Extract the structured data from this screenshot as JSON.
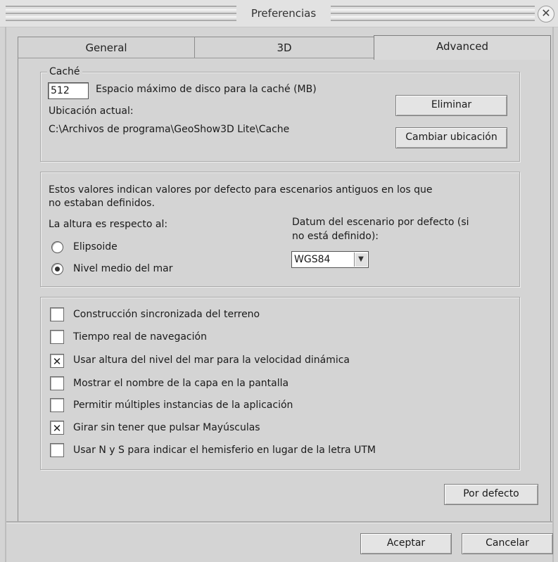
{
  "window": {
    "title": "Preferencias",
    "close_glyph": "✕"
  },
  "tabs": [
    {
      "label": "General",
      "active": false
    },
    {
      "label": "3D",
      "active": false
    },
    {
      "label": "Advanced",
      "active": true
    }
  ],
  "cache": {
    "legend": "Caché",
    "size_value": "512",
    "size_label": "Espacio máximo de disco para la caché (MB)",
    "location_label": "Ubicación actual:",
    "location_path": "C:\\Archivos de programa\\GeoShow3D Lite\\Cache",
    "delete_button": "Eliminar",
    "change_button": "Cambiar ubicación"
  },
  "defaults": {
    "intro_line1": "Estos valores indican valores por defecto para escenarios antiguos en los que",
    "intro_line2": "no estaban definidos.",
    "height_label": "La altura es respecto al:",
    "radio_options": [
      {
        "label": "Elipsoide",
        "selected": false
      },
      {
        "label": "Nivel medio del mar",
        "selected": true
      }
    ],
    "datum_label_line1": "Datum del escenario por defecto (si",
    "datum_label_line2": "no está definido):",
    "datum_value": "WGS84",
    "dropdown_icon": "▼"
  },
  "options": [
    {
      "label": "Construcción sincronizada del terreno",
      "checked": false,
      "mark": ""
    },
    {
      "label": "Tiempo real de navegación",
      "checked": false,
      "mark": ""
    },
    {
      "label": "Usar altura del nivel del mar para la velocidad dinámica",
      "checked": true,
      "mark": "✕"
    },
    {
      "label": "Mostrar el nombre de la capa en la pantalla",
      "checked": false,
      "mark": ""
    },
    {
      "label": "Permitir múltiples instancias de la aplicación",
      "checked": false,
      "mark": ""
    },
    {
      "label": "Girar sin tener que pulsar Mayúsculas",
      "checked": true,
      "mark": "✕"
    },
    {
      "label": "Usar N y S para indicar el hemisferio en lugar de la letra UTM",
      "checked": false,
      "mark": ""
    }
  ],
  "buttons": {
    "defaults": "Por defecto",
    "accept": "Aceptar",
    "cancel": "Cancelar"
  }
}
